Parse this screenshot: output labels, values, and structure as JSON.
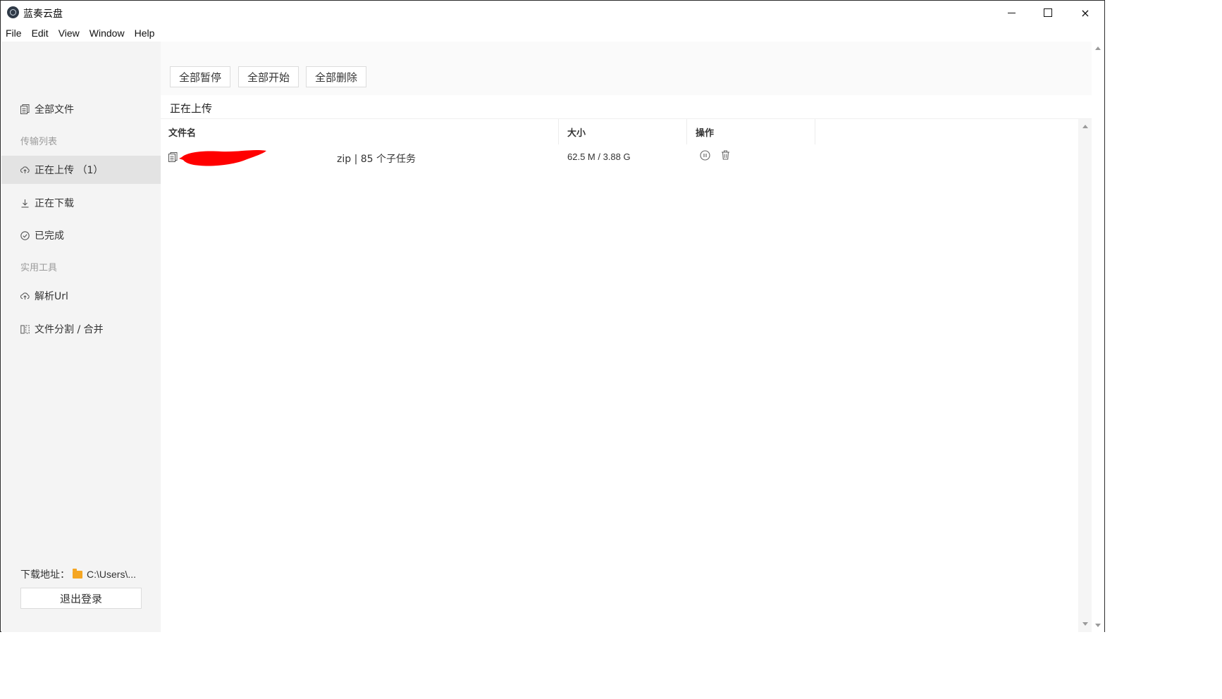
{
  "window": {
    "title": "蓝奏云盘",
    "controls": {
      "minimize": "minimize",
      "maximize": "maximize",
      "close": "×"
    }
  },
  "menu": [
    "File",
    "Edit",
    "View",
    "Window",
    "Help"
  ],
  "sidebar": {
    "all_files": "全部文件",
    "transfer_group": "传输列表",
    "uploading": "正在上传 （1）",
    "downloading": "正在下载",
    "completed": "已完成",
    "tools_group": "实用工具",
    "parse_url": "解析Url",
    "split_merge": "文件分割 / 合并",
    "download_label": "下载地址：",
    "download_path": "C:\\Users\\...",
    "logout": "退出登录"
  },
  "toolbar": {
    "pause_all": "全部暂停",
    "start_all": "全部开始",
    "delete_all": "全部删除"
  },
  "section_title": "正在上传",
  "table": {
    "columns": [
      "文件名",
      "大小",
      "操作"
    ],
    "rows": [
      {
        "file_meta": "zip | 85 个子任务",
        "size": "62.5 M / 3.88 G"
      }
    ]
  },
  "icons": {
    "all_files": "document-icon",
    "uploading": "cloud-upload-icon",
    "downloading": "download-icon",
    "completed": "check-circle-icon",
    "parse_url": "cloud-upload-icon",
    "split_merge": "split-icon",
    "folder": "folder-icon",
    "pause": "pause-circle-icon",
    "delete": "trash-icon"
  },
  "colors": {
    "sidebar_bg": "#f4f4f4",
    "active_item_bg": "#e3e3e3",
    "folder": "#f5a623",
    "redaction": "#ff0000"
  }
}
